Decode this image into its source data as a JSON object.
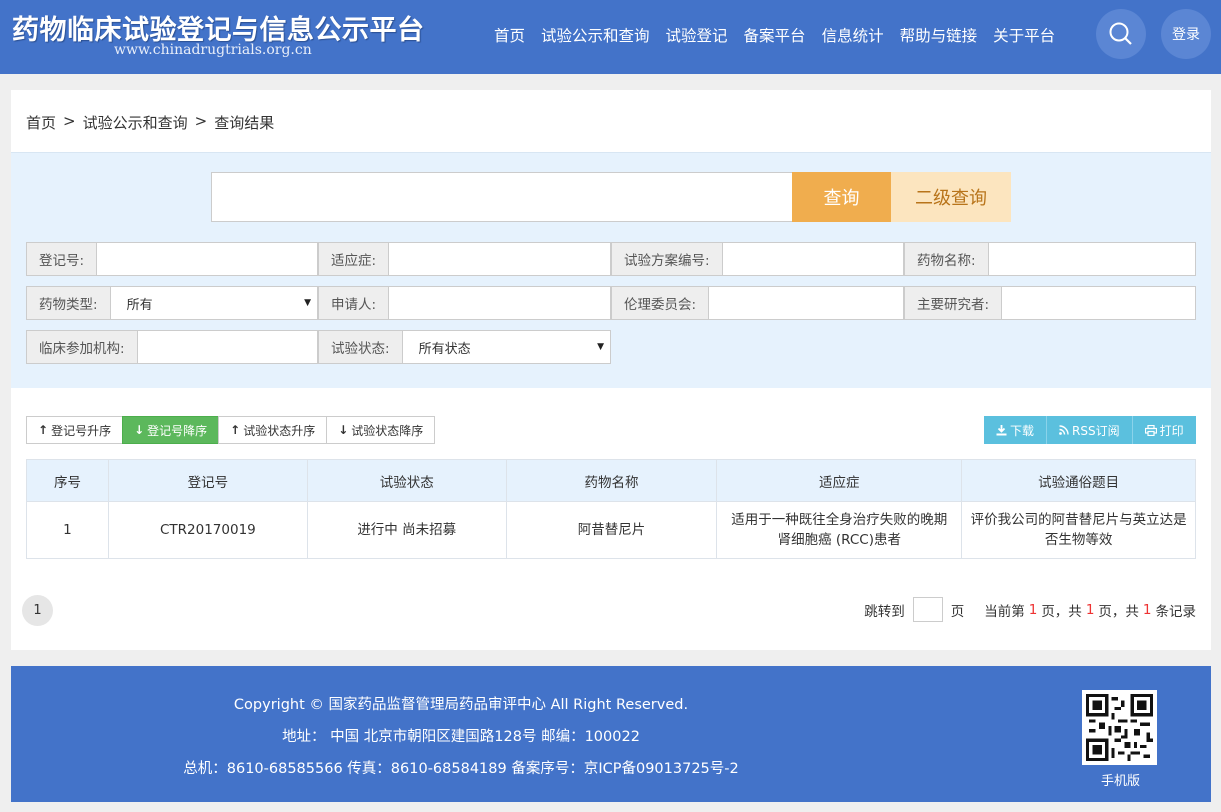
{
  "header": {
    "title": "药物临床试验登记与信息公示平台",
    "subtitle": "www.chinadrugtrials.org.cn",
    "nav": [
      "首页",
      "试验公示和查询",
      "试验登记",
      "备案平台",
      "信息统计",
      "帮助与链接",
      "关于平台"
    ],
    "search_icon": "search-icon",
    "login_label": "登录"
  },
  "breadcrumb": {
    "home": "首页",
    "sep": ">",
    "level2": "试验公示和查询",
    "current": "查询结果"
  },
  "search": {
    "query_button": "查询",
    "advanced_button": "二级查询",
    "fields": {
      "reg_no": "登记号:",
      "indication": "适应症:",
      "protocol_no": "试验方案编号:",
      "drug_name": "药物名称:",
      "drug_type": "药物类型:",
      "drug_type_value": "所有",
      "applicant": "申请人:",
      "ethics": "伦理委员会:",
      "investigator": "主要研究者:",
      "site": "临床参加机构:",
      "status": "试验状态:",
      "status_value": "所有状态"
    }
  },
  "sort": {
    "reg_asc": "登记号升序",
    "reg_desc": "登记号降序",
    "status_asc": "试验状态升序",
    "status_desc": "试验状态降序"
  },
  "tools": {
    "download": "下载",
    "rss": "RSS订阅",
    "print": "打印"
  },
  "table": {
    "headers": [
      "序号",
      "登记号",
      "试验状态",
      "药物名称",
      "适应症",
      "试验通俗题目"
    ],
    "rows": [
      [
        "1",
        "CTR20170019",
        "进行中 尚未招募",
        "阿昔替尼片",
        "适用于一种既往全身治疗失败的晚期肾细胞癌 (RCC)患者",
        "评价我公司的阿昔替尼片与英立达是否生物等效"
      ]
    ]
  },
  "pager": {
    "page": "1",
    "jump_to": "跳转到",
    "page_unit": "页",
    "current_prefix": "当前第",
    "current": "1",
    "current_suffix": "页，共",
    "total_pages": "1",
    "total_suffix": "页，共",
    "total_records": "1",
    "records_suffix": "条记录"
  },
  "footer": {
    "copyright": "Copyright © 国家药品监督管理局药品审评中心 All Right Reserved.",
    "address": "地址： 中国 北京市朝阳区建国路128号 邮编：100022",
    "contact": "总机：8610-68585566 传真：8610-68584189 备案序号：京ICP备09013725号-2",
    "mobile": "手机版"
  },
  "colors": {
    "header_bg": "#4373c9",
    "query_btn": "#f0ad4e",
    "sort_active": "#5cb85c",
    "tool_btn": "#5bc0de",
    "highlight": "#e33333"
  }
}
